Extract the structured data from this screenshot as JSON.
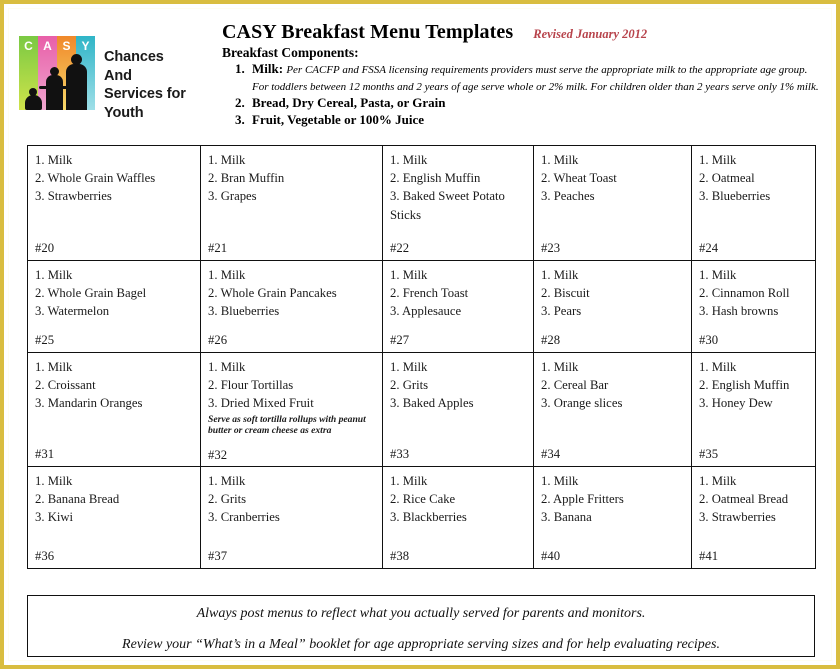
{
  "document": {
    "title": "CASY Breakfast Menu Templates",
    "revised": "Revised January 2012"
  },
  "logo": {
    "letters": [
      "C",
      "A",
      "S",
      "Y"
    ],
    "name_lines": [
      "Chances",
      "And",
      "Services for",
      "Youth"
    ],
    "band_colors": [
      "#7ac943",
      "#e85fa8",
      "#f0882a",
      "#2fb5c7"
    ],
    "letter_color": "#ffffff"
  },
  "components": {
    "heading": "Breakfast Components:",
    "items": [
      {
        "label": "Milk:",
        "note": "Per CACFP and FSSA licensing requirements providers must serve the appropriate milk to the appropriate age group. For toddlers between 12 months and 2 years of age serve whole or 2% milk. For children older than 2 years serve only 1% milk."
      },
      {
        "label": "Bread, Dry Cereal, Pasta, or Grain",
        "note": ""
      },
      {
        "label": "Fruit, Vegetable or 100% Juice",
        "note": ""
      }
    ]
  },
  "menus": [
    [
      {
        "id": "#20",
        "items": [
          "1. Milk",
          "2. Whole Grain Waffles",
          "3. Strawberries"
        ],
        "note": ""
      },
      {
        "id": "#21",
        "items": [
          "1. Milk",
          "2. Bran Muffin",
          "3. Grapes"
        ],
        "note": ""
      },
      {
        "id": "#22",
        "items": [
          "1. Milk",
          "2. English Muffin",
          "3. Baked Sweet Potato Sticks"
        ],
        "note": ""
      },
      {
        "id": "#23",
        "items": [
          "1.  Milk",
          "2. Wheat Toast",
          "3.  Peaches"
        ],
        "note": ""
      },
      {
        "id": "#24",
        "items": [
          "1.  Milk",
          "2. Oatmeal",
          "3. Blueberries"
        ],
        "note": ""
      }
    ],
    [
      {
        "id": "#25",
        "items": [
          "1. Milk",
          "2. Whole Grain Bagel",
          "3. Watermelon"
        ],
        "note": ""
      },
      {
        "id": "#26",
        "items": [
          "1. Milk",
          "2. Whole Grain Pancakes",
          "3. Blueberries"
        ],
        "note": ""
      },
      {
        "id": "#27",
        "items": [
          "1. Milk",
          "2. French Toast",
          "3. Applesauce"
        ],
        "note": ""
      },
      {
        "id": "#28",
        "items": [
          "1.  Milk",
          "2.  Biscuit",
          "3.  Pears"
        ],
        "note": ""
      },
      {
        "id": "#30",
        "items": [
          "1.  Milk",
          "2.  Cinnamon Roll",
          "3.  Hash browns"
        ],
        "note": ""
      }
    ],
    [
      {
        "id": "#31",
        "items": [
          "1.  Milk",
          "2.  Croissant",
          "3.  Mandarin Oranges"
        ],
        "note": ""
      },
      {
        "id": "#32",
        "items": [
          "1.  Milk",
          "2.  Flour Tortillas",
          "3.  Dried Mixed Fruit"
        ],
        "note": "Serve as soft tortilla  rollups with peanut butter or cream cheese as extra"
      },
      {
        "id": "#33",
        "items": [
          "1.  Milk",
          "2.  Grits",
          "3.  Baked Apples"
        ],
        "note": ""
      },
      {
        "id": "#34",
        "items": [
          "1.  Milk",
          "2.  Cereal Bar",
          "3.  Orange slices"
        ],
        "note": ""
      },
      {
        "id": "#35",
        "items": [
          "1.  Milk",
          "2.  English Muffin",
          "3.  Honey Dew"
        ],
        "note": ""
      }
    ],
    [
      {
        "id": "#36",
        "items": [
          "1. Milk",
          "2. Banana Bread",
          "3. Kiwi"
        ],
        "note": ""
      },
      {
        "id": "#37",
        "items": [
          "1. Milk",
          "2. Grits",
          "3. Cranberries"
        ],
        "note": ""
      },
      {
        "id": "#38",
        "items": [
          "1. Milk",
          "2. Rice Cake",
          "3. Blackberries"
        ],
        "note": ""
      },
      {
        "id": "#40",
        "items": [
          "1. Milk",
          "2. Apple Fritters",
          "3. Banana"
        ],
        "note": ""
      },
      {
        "id": "#41",
        "items": [
          "1. Milk",
          "2. Oatmeal Bread",
          "3. Strawberries"
        ],
        "note": ""
      }
    ]
  ],
  "footer": {
    "line1": "Always post menus to reflect what you actually served for parents and monitors.",
    "line2": "Review your “What’s in a Meal” booklet for age appropriate serving sizes and for help evaluating recipes."
  },
  "colors": {
    "page_border": "#d9bd3f",
    "revised_text": "#b7434b",
    "grid_line": "#111111"
  }
}
